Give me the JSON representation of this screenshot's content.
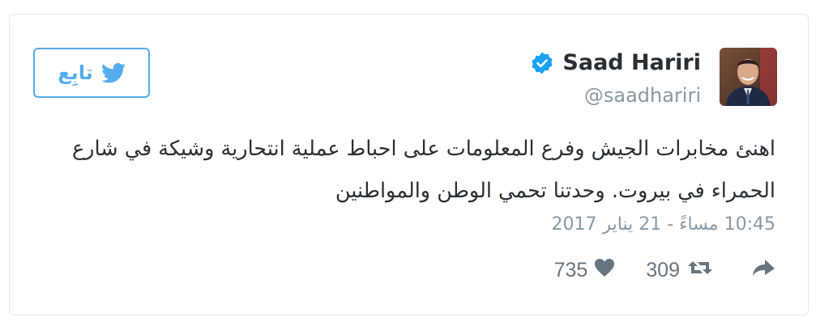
{
  "follow_button": {
    "label": "تابِع",
    "icon": "twitter-bird-icon"
  },
  "author": {
    "name": "Saad Hariri",
    "handle": "@saadhariri",
    "verified": true,
    "avatar_icon": "avatar"
  },
  "tweet": {
    "text": "اهنئ مخابرات الجيش وفرع المعلومات على احباط عملية انتحارية وشيكة في شارع الحمراء في بيروت. وحدتنا تحمي الوطن والمواطنين",
    "timestamp": "10:45 مساءً - 21 يناير 2017"
  },
  "actions": {
    "reply_icon": "reply-icon",
    "retweet_icon": "retweet-icon",
    "retweet_count": "309",
    "like_icon": "heart-icon",
    "like_count": "735"
  },
  "colors": {
    "accent": "#55acee",
    "verified": "#1da1f2",
    "muted": "#8899a6",
    "text": "#292f33",
    "border": "#e1e8ed"
  }
}
